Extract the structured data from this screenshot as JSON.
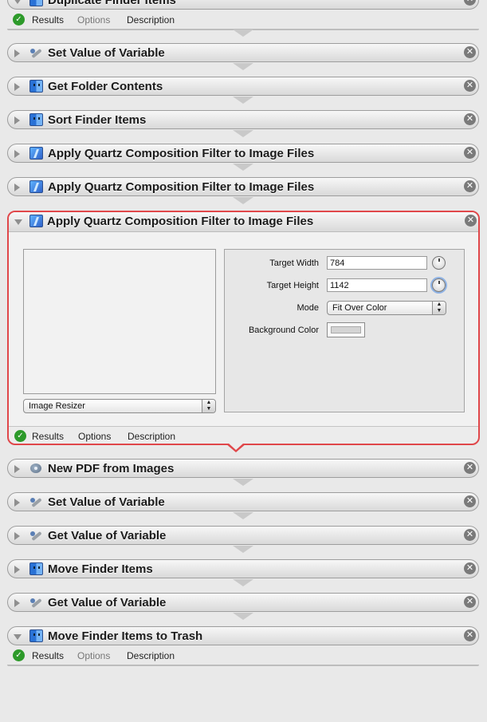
{
  "actions": [
    {
      "title": "Duplicate Finder Items",
      "icon": "finder"
    },
    {
      "title": "Set Value of Variable",
      "icon": "var"
    },
    {
      "title": "Get Folder Contents",
      "icon": "finder"
    },
    {
      "title": "Sort Finder Items",
      "icon": "finder"
    },
    {
      "title": "Apply Quartz Composition Filter to Image Files",
      "icon": "quartz"
    },
    {
      "title": "Apply Quartz Composition Filter to Image Files",
      "icon": "quartz"
    },
    {
      "title": "Apply Quartz Composition Filter to Image Files",
      "icon": "quartz"
    },
    {
      "title": "New PDF from Images",
      "icon": "pdf"
    },
    {
      "title": "Set Value of Variable",
      "icon": "var"
    },
    {
      "title": "Get Value of Variable",
      "icon": "var"
    },
    {
      "title": "Move Finder Items",
      "icon": "finder"
    },
    {
      "title": "Get Value of Variable",
      "icon": "var"
    },
    {
      "title": "Move Finder Items to Trash",
      "icon": "finder"
    }
  ],
  "footer": {
    "results": "Results",
    "options": "Options",
    "description": "Description"
  },
  "expanded": {
    "title": "Apply Quartz Composition Filter to Image Files",
    "composition": "Image Resizer",
    "target_width_label": "Target Width",
    "target_width": "784",
    "target_height_label": "Target Height",
    "target_height": "1142",
    "mode_label": "Mode",
    "mode": "Fit Over Color",
    "background_color_label": "Background Color"
  },
  "icons": {
    "close": "close-icon",
    "check": "checkmark-icon"
  }
}
